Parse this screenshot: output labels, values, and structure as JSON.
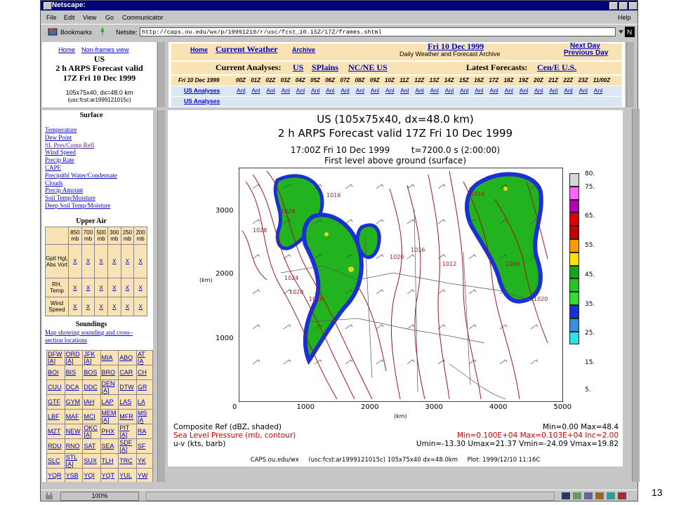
{
  "window": {
    "title": "Netscape:"
  },
  "menu": {
    "file": "File",
    "edit": "Edit",
    "view": "View",
    "go": "Go",
    "communicator": "Communicator",
    "help": "Help"
  },
  "nav": {
    "bookmarks": "Bookmarks",
    "netsite_label": "Netsite:",
    "url": "http://caps.ou.edu/wx/p/19991210/r/usc/fcst_10.15Z/17Z/frames.shtml"
  },
  "left": {
    "home": "Home",
    "nonframes": "Non-frames view",
    "region": "US",
    "forecast_line1": "2 h ARPS Forecast valid",
    "forecast_line2": "17Z Fri 10 Dec 1999",
    "grid": "105x75x40, dx=48.0 km",
    "file": "(usc:fcst:ar1999121015c)",
    "surface_heading": "Surface",
    "surface_links": [
      "Temperature",
      "Dew Point",
      "SL Pres/Comp Refl",
      "Wind Speed",
      "Precip Rate",
      "CAPE",
      "Precipitbl Water/Condensate",
      "Clouds",
      "Precip Amount",
      "Soil Temp/Moisture",
      "Deep Soil Temp/Moisture"
    ],
    "upper_heading": "Upper Air",
    "levels": [
      "850 mb",
      "700 mb",
      "500 mb",
      "300 mb",
      "250 mb",
      "200 mb"
    ],
    "upper_rows": [
      "Gptl Hgt, Abs Vort",
      "RH, Temp",
      "Wind Speed"
    ],
    "x": "X",
    "soundings_heading": "Soundings",
    "soundings_link": "Map showing sounding and cross–section locations",
    "stations": [
      [
        "DFW [A]",
        "ORD [A]",
        "JFK [A]",
        "MIA",
        "ABQ",
        "AT [A"
      ],
      [
        "BOI",
        "BIS",
        "BOS",
        "BRO",
        "CAR",
        "CH"
      ],
      [
        "CUU",
        "DCA",
        "DDC",
        "DEN [A]",
        "DTW",
        "GR"
      ],
      [
        "GTF",
        "GYM",
        "IAH",
        "LAP",
        "LAS",
        "LA"
      ],
      [
        "LBF",
        "MAF",
        "MCI",
        "MEM [A]",
        "MFR",
        "MS [A"
      ],
      [
        "MZT",
        "NEW",
        "OKC [A]",
        "PHX",
        "PIT [A]",
        "RA"
      ],
      [
        "RDU",
        "RNO",
        "SAT",
        "SEA",
        "SDF [A]",
        "SF"
      ],
      [
        "SLC",
        "STL [A]",
        "SUX",
        "TLH",
        "TRC",
        "YK"
      ],
      [
        "YQR",
        "YSB",
        "YQI",
        "YQT",
        "YUL",
        "YW"
      ]
    ]
  },
  "top": {
    "home": "Home",
    "current": "Current Weather",
    "archive": "Archive",
    "date": "Fri 10 Dec 1999",
    "subtitle": "Daily Weather and Forecast Archive",
    "next_day": "Next Day",
    "prev_day": "Previous Day",
    "analyses_label": "Current Analyses:",
    "us": "US",
    "splains": "SPlains",
    "ncne": "NC/NE US",
    "latest_label": "Latest Forecasts:",
    "cen": "Cen/E U.S.",
    "time_header": "Fri 10 Dec 1999",
    "times": [
      "00Z",
      "01Z",
      "02Z",
      "03Z",
      "04Z",
      "05Z",
      "06Z",
      "07Z",
      "08Z",
      "09Z",
      "10Z",
      "11Z",
      "12Z",
      "13Z",
      "14Z",
      "15Z",
      "16Z",
      "17Z",
      "18Z",
      "19Z",
      "20Z",
      "21Z",
      "22Z",
      "23Z",
      "11/00Z"
    ],
    "row1_label": "US Analyses",
    "row2_label": "US Analyses",
    "anl": "Anl"
  },
  "plot": {
    "title1": "US (105x75x40, dx=48.0 km)",
    "title2": "2 h ARPS Forecast valid 17Z Fri 10 Dec 1999",
    "time_line": "17:00Z Fri 10 Dec 1999        t=7200.0 s (2:00:00)",
    "level_line": "First level above ground (surface)",
    "xlabel": "(km)",
    "ylabel": "(km)",
    "xticks": [
      "0",
      "1000",
      "2000",
      "3000",
      "4000",
      "5000"
    ],
    "yticks": [
      "1000",
      "2000",
      "3000"
    ],
    "colorbar": [
      "80.",
      "75.",
      "65.",
      "55.",
      "45.",
      "35.",
      "25.",
      "15.",
      "5."
    ],
    "legend1": "Composite Ref (dBZ, shaded)",
    "legend2": "Sea Level Pressure (mb, contour)",
    "legend3": "u-v (kts, barb)",
    "stats1": "Min=0.00 Max=48.4",
    "stats2": "Min=0.100E+04 Max=0.103E+04 Inc=2.00",
    "stats3": "Umin=-13.30 Umax=21.37 Vmin=-24.09 Vmax=19.82",
    "footer": "CAPS.ou.edu/wx     (usc:fcst:ar1999121015c) 105x75x40 dx=48.0km     Plot: 1999/12/10 11:16C",
    "contours": [
      "1024",
      "1016",
      "1028",
      "1024",
      "1020",
      "1016",
      "1020",
      "1016",
      "1012",
      "1008",
      "1016",
      "1020"
    ]
  },
  "status": {
    "zoom": "100%"
  },
  "page_number": "13",
  "colors": {
    "titlebar": "#00007b",
    "chrome": "#c6c6c6",
    "link": "#0000cc",
    "cell": "#f9e3b4",
    "contour": "#9b1b1b",
    "radar_green": "#22b31e"
  }
}
